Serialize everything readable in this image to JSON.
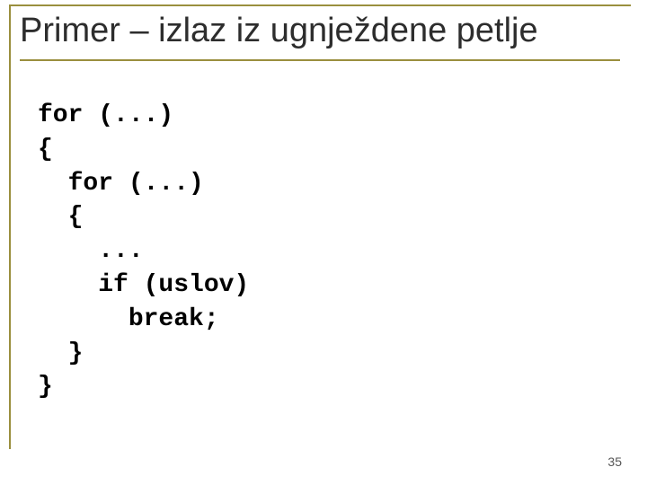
{
  "title": "Primer – izlaz iz ugnježdene petlje",
  "code": {
    "l1": "for (...)",
    "l2": "{",
    "l3": "  for (...)",
    "l4": "  {",
    "l5": "    ...",
    "l6": "    if (uslov)",
    "l7": "      break;",
    "l8": "  }",
    "l9": "}"
  },
  "page_number": "35"
}
